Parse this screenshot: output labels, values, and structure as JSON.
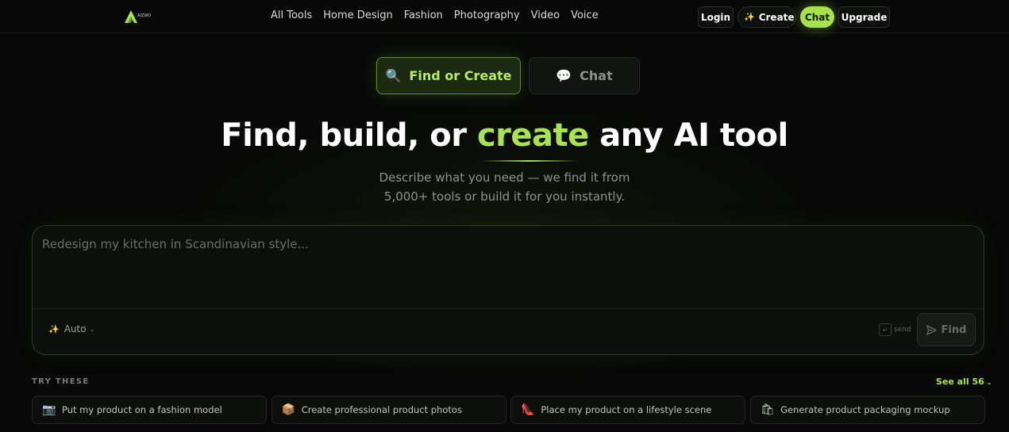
{
  "nav": {
    "logo_text": "AIZWO",
    "links": [
      "All Tools",
      "Home Design",
      "Fashion",
      "Photography",
      "Video",
      "Voice"
    ],
    "login": "Login",
    "create": "Create",
    "chat": "Chat",
    "upgrade": "Upgrade"
  },
  "mode": {
    "find_label": "Find or Create",
    "find_icon": "magnifier-icon",
    "chat_label": "Chat",
    "chat_icon": "speech-bubble-icon",
    "active": "find"
  },
  "hero": {
    "title_pre": "Find, build, or",
    "title_accent": "create",
    "title_post": "any AI tool",
    "subtitle_line1": "Describe what you need — we find it from",
    "subtitle_line2": "5,000+ tools or build it for you instantly."
  },
  "prompt": {
    "placeholder": "Redesign my kitchen in Scandinavian style...",
    "mode_label": "Auto",
    "send_hint": "send",
    "send_key": "↵",
    "find_button": "Find"
  },
  "suggestions": {
    "label": "TRY THESE",
    "see_all": "See all 56",
    "items": [
      {
        "emoji": "📷",
        "text": "Put my product on a fashion model"
      },
      {
        "emoji": "📦",
        "text": "Create professional product photos"
      },
      {
        "emoji": "👠",
        "text": "Place my product on a lifestyle scene"
      },
      {
        "emoji": "🛍",
        "text": "Generate product packaging mockup"
      }
    ]
  },
  "colors": {
    "accent": "#a9e34e",
    "background": "#070807",
    "card_border": "#2c3f1f"
  }
}
